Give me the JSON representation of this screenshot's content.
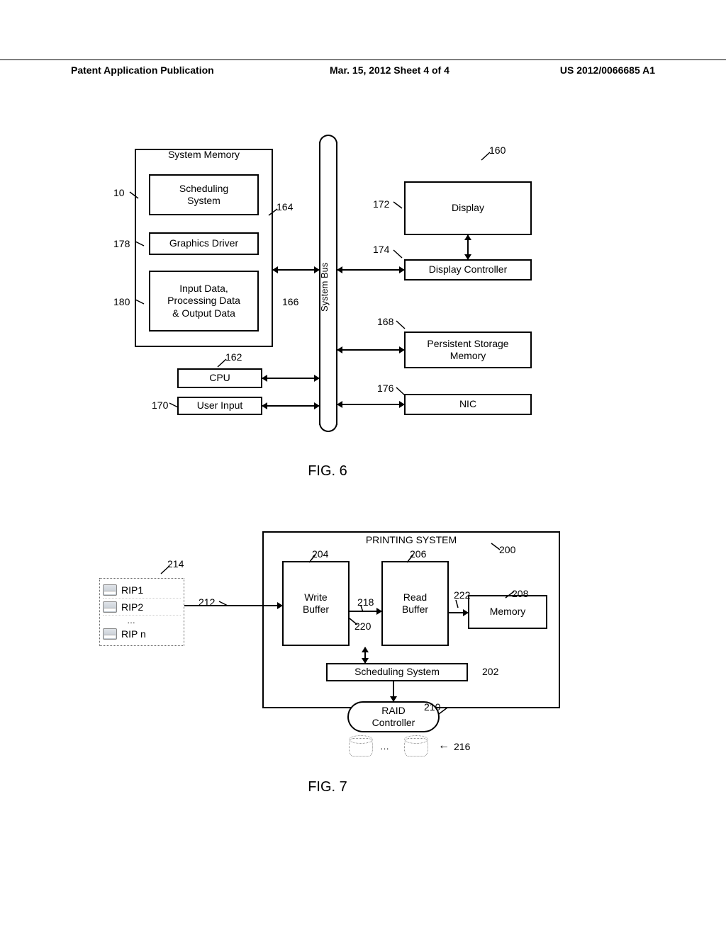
{
  "header": {
    "pub": "Patent Application Publication",
    "date_sheet": "Mar. 15, 2012   Sheet 4 of 4",
    "docnum": "US 2012/0066685 A1"
  },
  "fig6": {
    "caption": "FIG. 6",
    "sysmem_title": "System Memory",
    "scheduling": "Scheduling\nSystem",
    "graphics": "Graphics Driver",
    "iodata": "Input Data,\nProcessing Data\n& Output Data",
    "cpu": "CPU",
    "user_input": "User Input",
    "sysbus": "System Bus",
    "display": "Display",
    "display_ctrl": "Display Controller",
    "pmem": "Persistent Storage\nMemory",
    "nic": "NIC",
    "refs": {
      "r10": "10",
      "r160": "160",
      "r162": "162",
      "r164": "164",
      "r166": "166",
      "r168": "168",
      "r170": "170",
      "r172": "172",
      "r174": "174",
      "r176": "176",
      "r178": "178",
      "r180": "180"
    }
  },
  "fig7": {
    "caption": "FIG. 7",
    "ps_title": "PRINTING SYSTEM",
    "write_buffer": "Write\nBuffer",
    "read_buffer": "Read\nBuffer",
    "memory": "Memory",
    "scheduling": "Scheduling System",
    "raid": "RAID\nController",
    "rip1": "RIP1",
    "rip2": "RIP2",
    "ripn": "RIP n",
    "rip_dots": "…",
    "disk_dots": "…",
    "refs": {
      "r200": "200",
      "r202": "202",
      "r204": "204",
      "r206": "206",
      "r208": "208",
      "r210": "210",
      "r212": "212",
      "r214": "214",
      "r216": "216",
      "r218": "218",
      "r220": "220",
      "r222": "222"
    }
  }
}
